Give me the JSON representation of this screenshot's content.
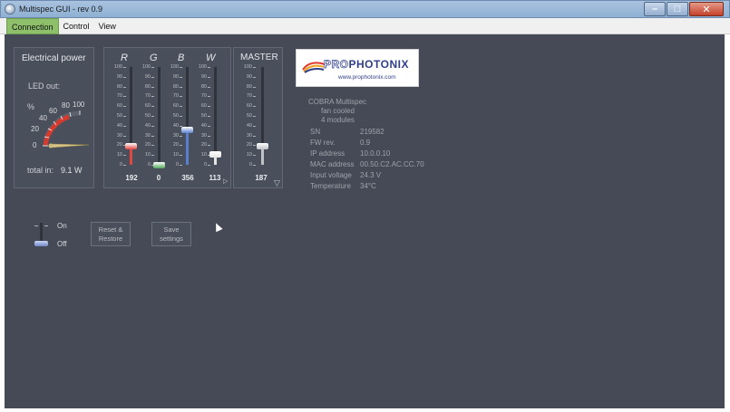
{
  "window": {
    "title": "Multispec GUI - rev 0.9"
  },
  "menu": [
    "Connection",
    "Control",
    "View"
  ],
  "power": {
    "title": "Electrical power",
    "led_label": "LED out:",
    "percent_label": "%",
    "gauge_ticks": [
      "0",
      "20",
      "40",
      "60",
      "80",
      "100"
    ],
    "total_label": "total in:",
    "total_value": "9.1 W"
  },
  "scale_ticks": [
    "100",
    "90",
    "80",
    "70",
    "60",
    "50",
    "40",
    "30",
    "20",
    "10",
    "0"
  ],
  "channels": [
    {
      "label": "R",
      "value": "192",
      "level_pct": 19,
      "color": "#e0473f"
    },
    {
      "label": "G",
      "value": "0",
      "level_pct": 0,
      "color": "#4fa657"
    },
    {
      "label": "B",
      "value": "356",
      "level_pct": 36,
      "color": "#5a7fcf"
    },
    {
      "label": "W",
      "value": "113",
      "level_pct": 11,
      "color": "#e5e5e5"
    }
  ],
  "master": {
    "label": "MASTER",
    "value": "187",
    "level_pct": 19,
    "color": "#bfc2c7"
  },
  "logo": {
    "pro": "PRO",
    "photonix": "PHOTONIX",
    "url": "www.prophotonix.com"
  },
  "device": {
    "name": "COBRA Multispec",
    "line2": "fan cooled",
    "line3": "4 modules",
    "rows": [
      {
        "key": "SN",
        "value": "219582"
      },
      {
        "key": "FW rev.",
        "value": "0.9"
      },
      {
        "key": "IP address",
        "value": "10.0.0.10"
      },
      {
        "key": "MAC address",
        "value": "00.50.C2.AC.CC.70"
      },
      {
        "key": "Input voltage",
        "value": "24.3 V"
      },
      {
        "key": "Temperature",
        "value": "34°C"
      }
    ]
  },
  "switch": {
    "on": "On",
    "off": "Off"
  },
  "buttons": {
    "reset": "Reset &\nRestore",
    "save": "Save\nsettings"
  },
  "colors": {
    "workspace": "#454a56",
    "active_menu": "#8ec06c"
  }
}
